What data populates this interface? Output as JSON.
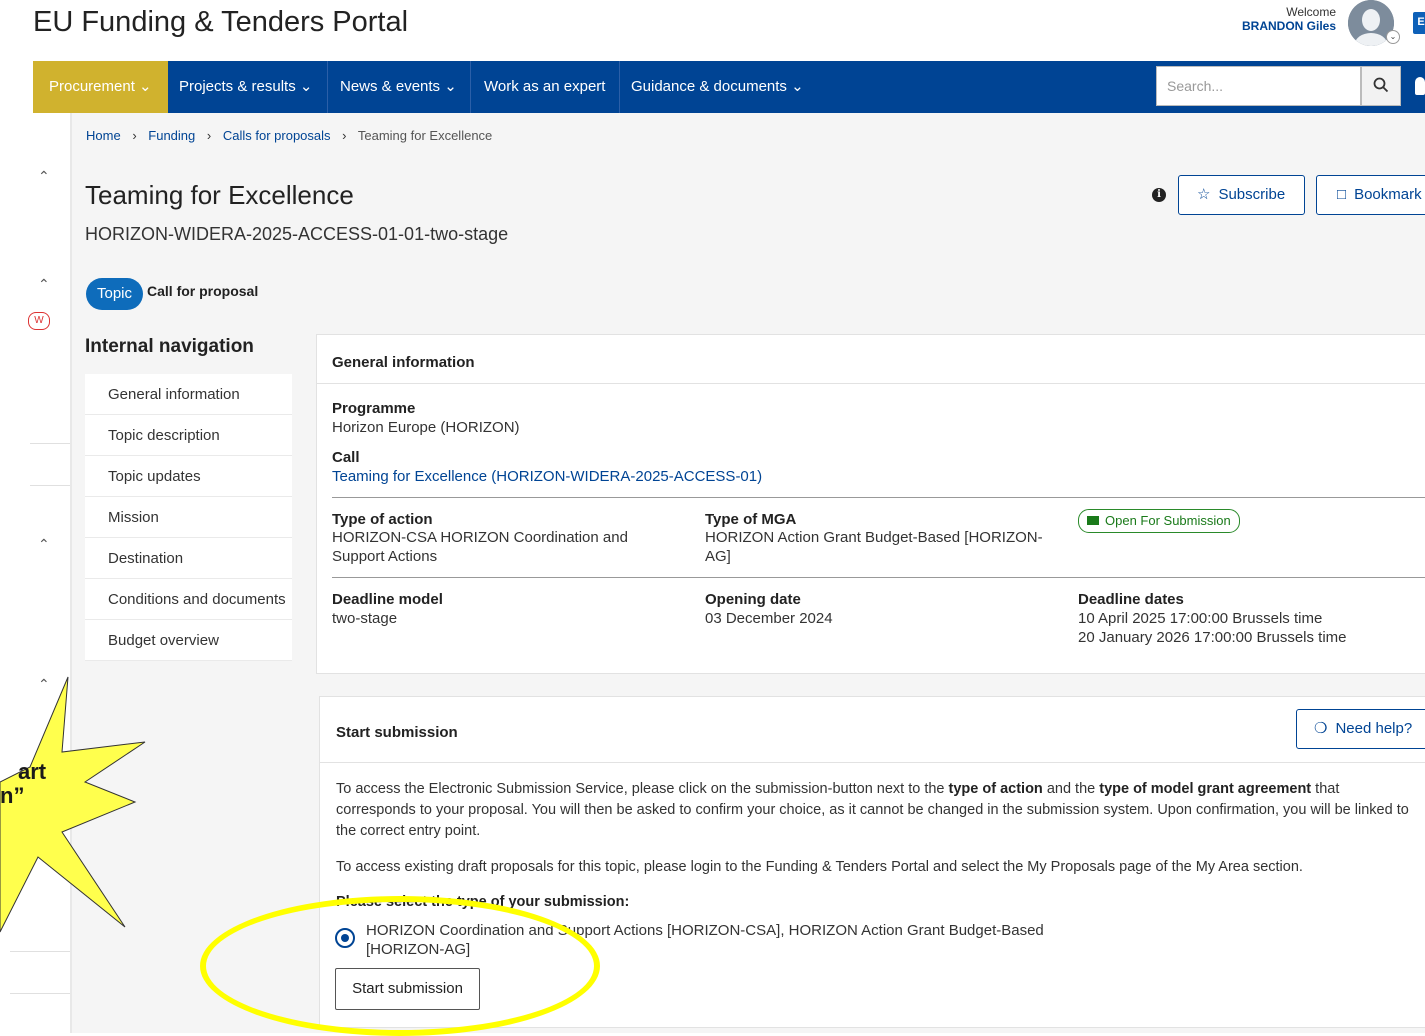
{
  "header": {
    "site_title": "EU Funding & Tenders Portal",
    "welcome_label": "Welcome",
    "user_name": "BRANDON Giles",
    "message_icon_letter": "E"
  },
  "nav": {
    "items": [
      {
        "label": "Procurement",
        "icon": "chevron-down-icon"
      },
      {
        "label": "Projects & results",
        "icon": "chevron-down-icon"
      },
      {
        "label": "News & events",
        "icon": "chevron-down-icon"
      },
      {
        "label": "Work as an expert",
        "icon": ""
      },
      {
        "label": "Guidance & documents",
        "icon": "chevron-down-icon"
      }
    ],
    "search_placeholder": "Search...",
    "accent_color": "#d0b22e",
    "bar_color": "#004494"
  },
  "breadcrumb": [
    "Home",
    "Funding",
    "Calls for proposals",
    "Teaming for Excellence"
  ],
  "page": {
    "title": "Teaming for Excellence",
    "identifier": "HORIZON-WIDERA-2025-ACCESS-01-01-two-stage",
    "topic_badge": "Topic",
    "call_type": "Call for proposal",
    "subscribe_label": "Subscribe",
    "bookmark_label": "Bookmark"
  },
  "internal_nav": {
    "title": "Internal navigation",
    "items": [
      "General information",
      "Topic description",
      "Topic updates",
      "Mission",
      "Destination",
      "Conditions and documents",
      "Budget overview"
    ]
  },
  "general_info": {
    "heading": "General information",
    "programme_label": "Programme",
    "programme_value": "Horizon Europe (HORIZON)",
    "call_label": "Call",
    "call_value": "Teaming for Excellence (HORIZON-WIDERA-2025-ACCESS-01)",
    "type_of_action_label": "Type of action",
    "type_of_action_value": "HORIZON-CSA HORIZON Coordination and Support Actions",
    "type_of_mga_label": "Type of MGA",
    "type_of_mga_value": "HORIZON Action Grant Budget-Based [HORIZON-AG]",
    "status": "Open For Submission",
    "status_color": "#1a7a1a",
    "deadline_model_label": "Deadline model",
    "deadline_model_value": "two-stage",
    "opening_date_label": "Opening date",
    "opening_date_value": "03 December 2024",
    "deadline_dates_label": "Deadline dates",
    "deadline_dates": [
      "10 April 2025 17:00:00 Brussels time",
      "20 January 2026 17:00:00 Brussels time"
    ]
  },
  "submission": {
    "heading": "Start submission",
    "need_help_label": "Need help?",
    "para1_a": "To access the Electronic Submission Service, please click on the submission-button next to the ",
    "para1_b": "type of action",
    "para1_c": " and the ",
    "para1_d": "type of model grant agreement",
    "para1_e": " that corresponds to your proposal. You will then be asked to confirm your choice, as it cannot be changed in the submission system. Upon confirmation, you will be linked to the correct entry point.",
    "para2": "To access existing draft proposals for this topic, please login to the Funding & Tenders Portal and select the My Proposals page of the My Area section.",
    "select_label": "Please select the type of your submission:",
    "option_label": "HORIZON Coordination and Support Actions [HORIZON-CSA], HORIZON Action Grant Budget-Based [HORIZON-AG]",
    "start_button": "Start submission"
  },
  "annotation": {
    "starburst_text_line1": "art",
    "starburst_text_line2": "n”",
    "highlight_color": "#ffff00"
  },
  "sidebar_badge": "W"
}
